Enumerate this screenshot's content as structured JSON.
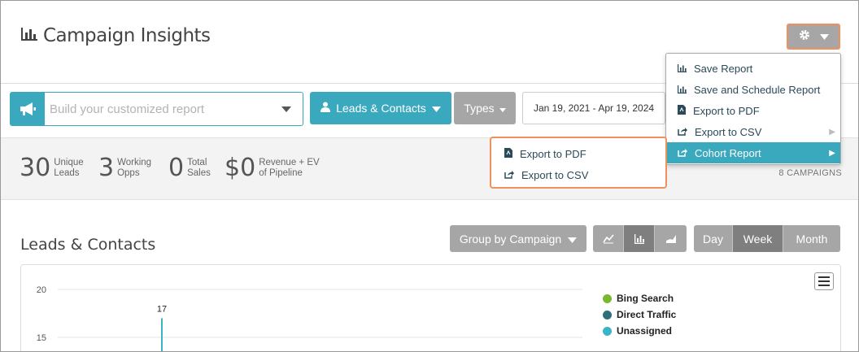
{
  "header": {
    "title": "Campaign Insights"
  },
  "search": {
    "placeholder": "Build your customized report"
  },
  "filters": {
    "leads_label": "Leads & Contacts",
    "types_label": "Types",
    "date_range": "Jan 19, 2021 - Apr 19, 2024"
  },
  "stats": [
    {
      "value": "30",
      "label_line1": "Unique",
      "label_line2": "Leads"
    },
    {
      "value": "3",
      "label_line1": "Working",
      "label_line2": "Opps"
    },
    {
      "value": "0",
      "label_line1": "Total",
      "label_line2": "Sales"
    },
    {
      "value": "$0",
      "label_line1": "Revenue + EV",
      "label_line2": "of Pipeline"
    }
  ],
  "campaigns_count": "8 CAMPAIGNS",
  "section": {
    "title": "Leads & Contacts",
    "group_by_label": "Group by Campaign",
    "period": [
      "Day",
      "Week",
      "Month"
    ],
    "active_period": "Week"
  },
  "gear_menu": {
    "items": [
      {
        "label": "Save Report",
        "icon": "chart-icon"
      },
      {
        "label": "Save and Schedule Report",
        "icon": "chart-icon"
      },
      {
        "label": "Export to PDF",
        "icon": "pdf-icon"
      },
      {
        "label": "Export to CSV",
        "icon": "export-icon"
      },
      {
        "label": "Cohort Report",
        "icon": "export-icon"
      }
    ]
  },
  "cohort_submenu": {
    "items": [
      {
        "label": "Export to PDF",
        "icon": "pdf-icon"
      },
      {
        "label": "Export to CSV",
        "icon": "export-icon"
      }
    ]
  },
  "colors": {
    "accent": "#3aa8bd",
    "button_gray": "#a6a6a6",
    "highlight_outline": "#f0905b"
  },
  "chart_data": {
    "type": "bar",
    "yticks": [
      20,
      15
    ],
    "series": [
      {
        "name": "Bing Search",
        "color": "#7cb82f"
      },
      {
        "name": "Direct Traffic",
        "color": "#2f6f7a"
      },
      {
        "name": "Unassigned",
        "color": "#3ab5c6"
      }
    ],
    "data_labels": [
      {
        "series": "Unassigned",
        "value": 17
      }
    ]
  }
}
